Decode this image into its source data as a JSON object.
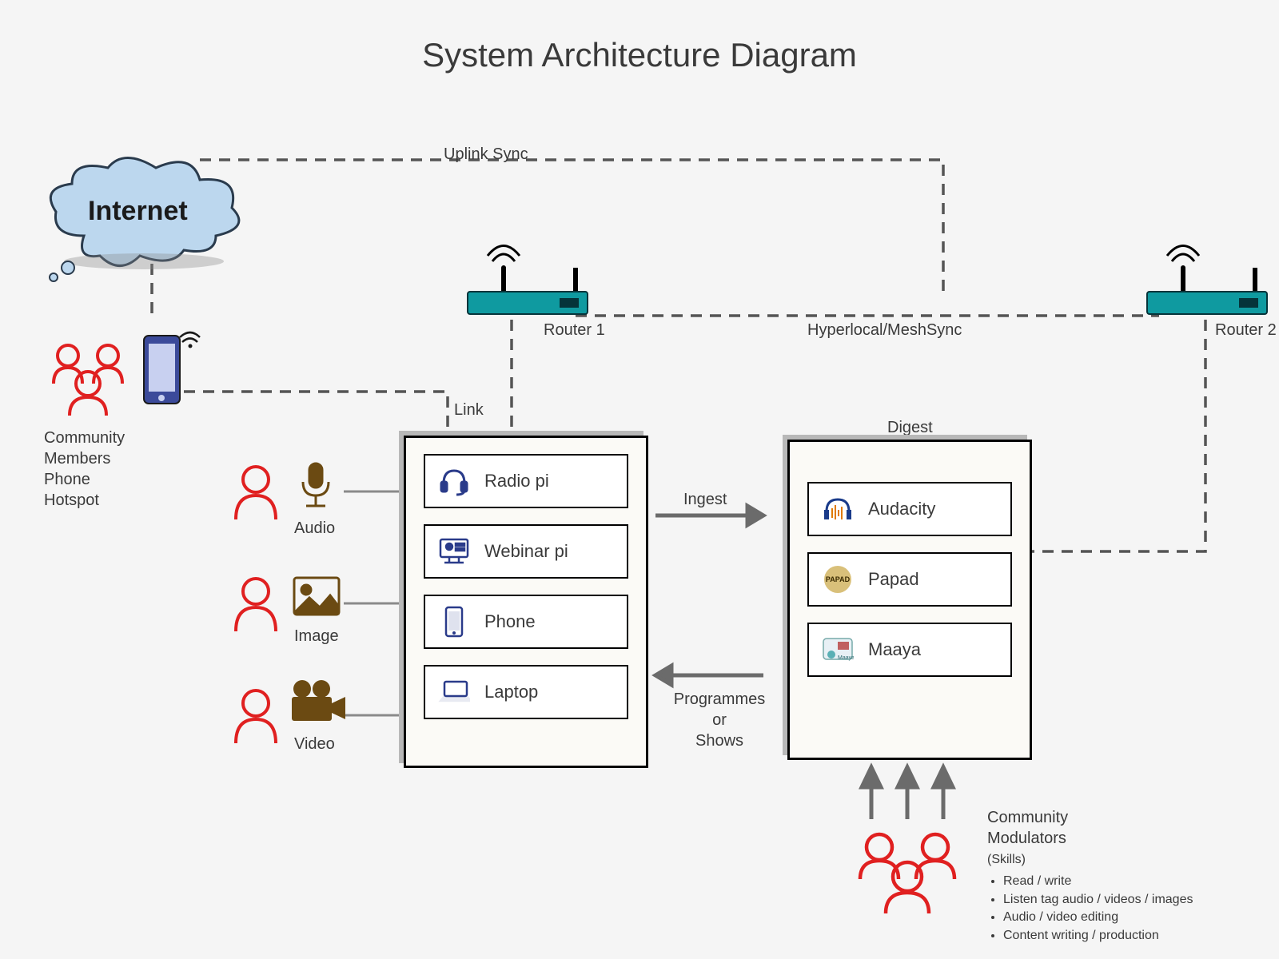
{
  "title": "System Architecture Diagram",
  "cloud": {
    "label": "Internet"
  },
  "community_members": {
    "line1": "Community",
    "line2": "Members",
    "line3": "Phone",
    "line4": "Hotspot"
  },
  "media": {
    "audio": "Audio",
    "image": "Image",
    "video": "Video"
  },
  "routers": {
    "r1": "Router 1",
    "r2": "Router 2"
  },
  "edges": {
    "uplink": "Uplink Sync",
    "link": "Link",
    "mesh": "Hyperlocal/MeshSync",
    "ingest": "Ingest",
    "programmes_l1": "Programmes",
    "programmes_l2": "or",
    "programmes_l3": "Shows",
    "digest": "Digest"
  },
  "leftbox": {
    "items": [
      {
        "label": "Radio pi"
      },
      {
        "label": "Webinar pi"
      },
      {
        "label": "Phone"
      },
      {
        "label": "Laptop"
      }
    ]
  },
  "rightbox": {
    "items": [
      {
        "label": "Audacity"
      },
      {
        "label": "Papad"
      },
      {
        "label": "Maaya"
      }
    ]
  },
  "modulators": {
    "title": "Community",
    "title2": "Modulators",
    "sub": "(Skills)",
    "skills": [
      "Read / write",
      "Listen tag audio / videos / images",
      "Audio / video editing",
      "Content writing / production"
    ]
  }
}
